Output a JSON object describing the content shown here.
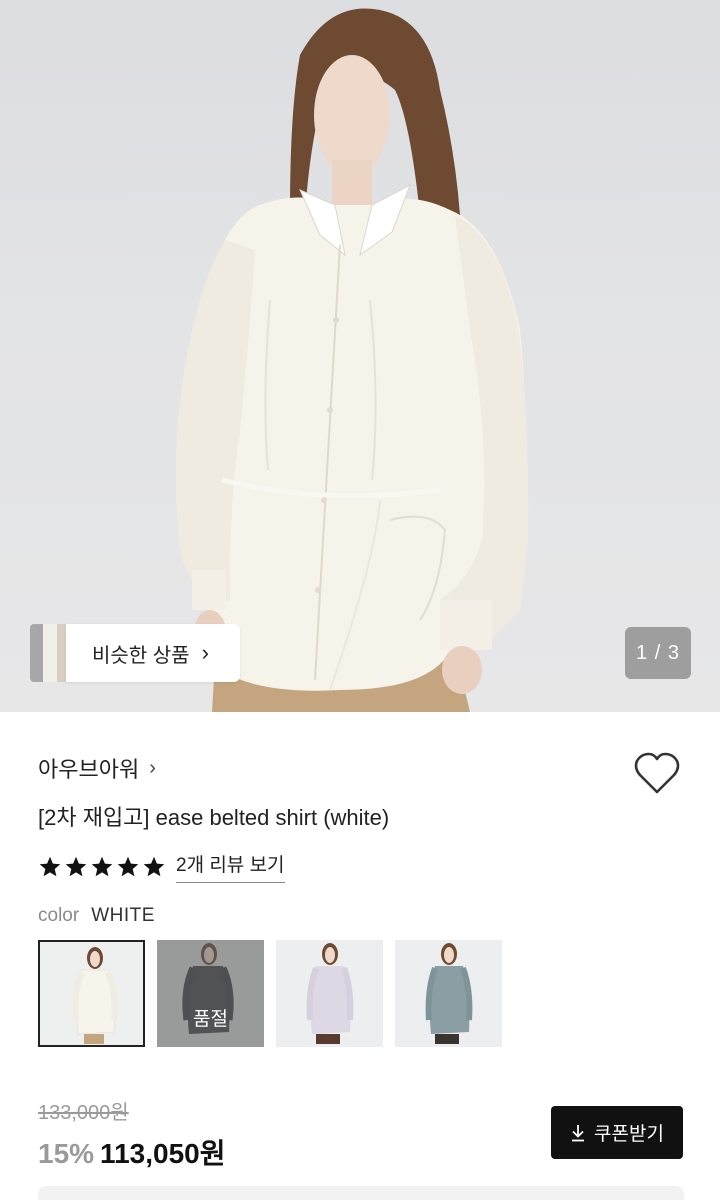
{
  "hero": {
    "similar_button_label": "비슷한 상품",
    "similar_chevron": "›",
    "page_counter": "1 / 3"
  },
  "product": {
    "brand": "아우브아워",
    "brand_chevron": "›",
    "title": "[2차 재입고] ease belted shirt (white)",
    "rating": 5,
    "review_link": "2개 리뷰 보기",
    "color_label": "color",
    "color_value": "WHITE",
    "swatches": [
      {
        "color": "white",
        "selected": true,
        "sold_out": false
      },
      {
        "color": "charcoal",
        "selected": false,
        "sold_out": true,
        "sold_out_label": "품절"
      },
      {
        "color": "lavender",
        "selected": false,
        "sold_out": false
      },
      {
        "color": "blue-gray",
        "selected": false,
        "sold_out": false
      }
    ],
    "original_price": "133,000원",
    "discount": "15%",
    "sale_price": "113,050원",
    "coupon_button": "쿠폰받기"
  },
  "icons": {
    "heart": "heart-outline-icon",
    "star": "star-filled-icon",
    "download": "download-icon",
    "chevron": "chevron-right-icon"
  },
  "colors": {
    "accent_black": "#111111",
    "muted_gray": "#9a9a9a",
    "hero_bg": "#e3e4e6"
  }
}
